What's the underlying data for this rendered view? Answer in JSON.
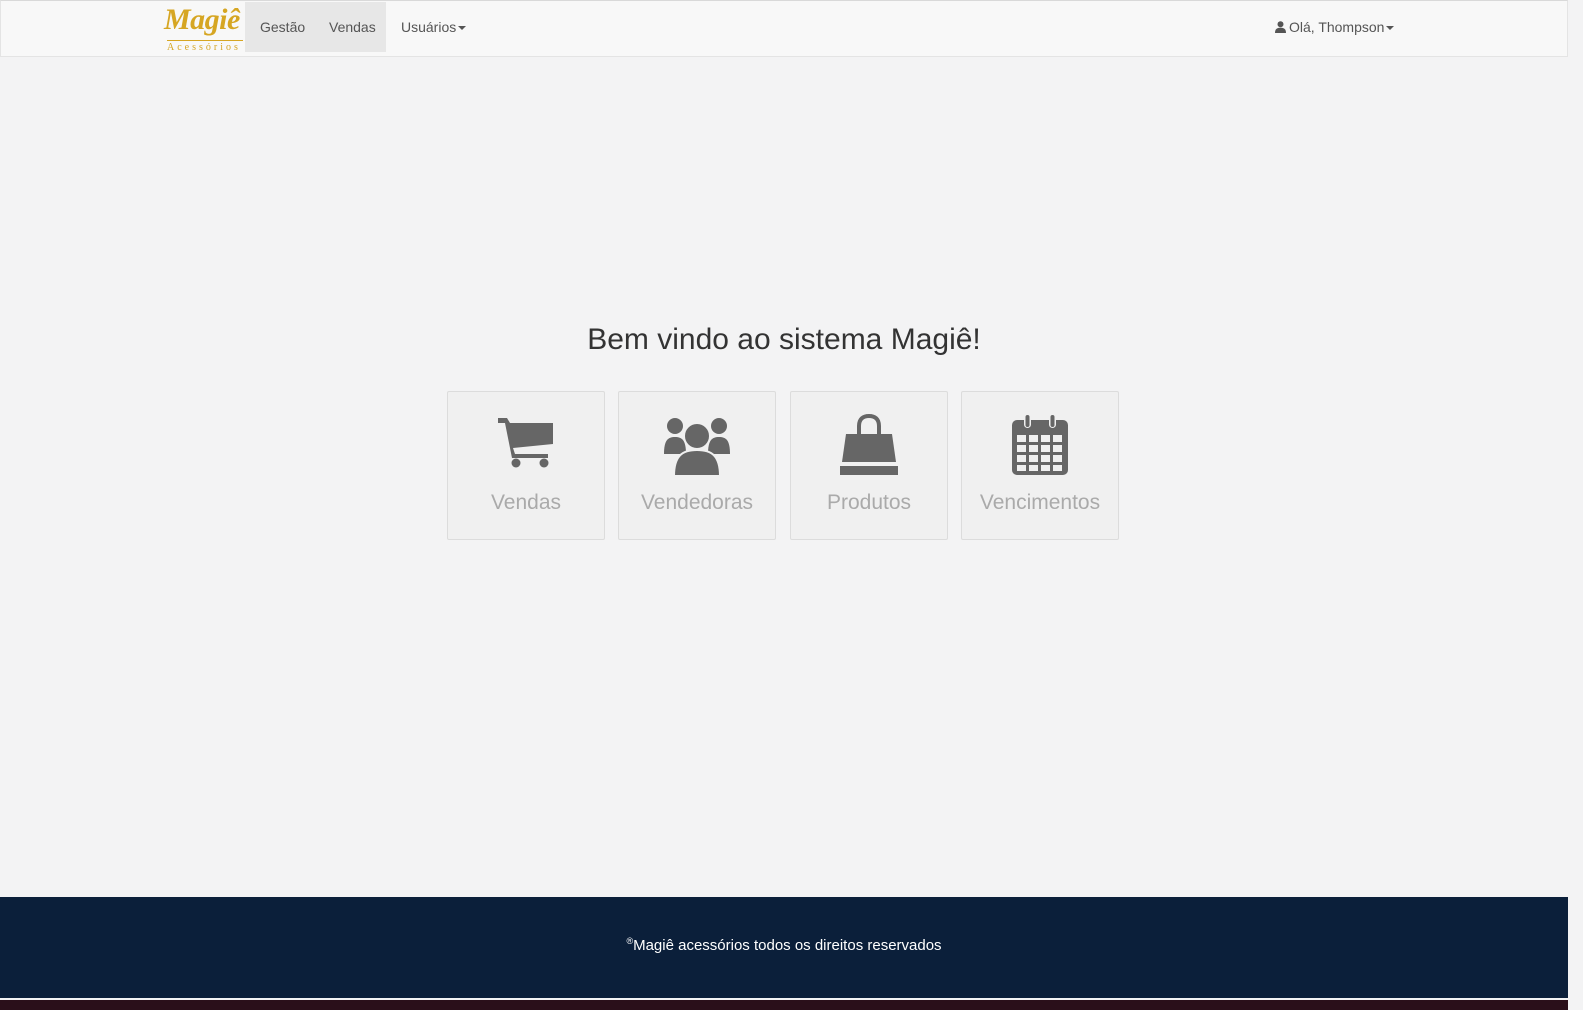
{
  "brand": {
    "name": "Magiê",
    "tagline": "Acessórios",
    "color": "#d6a623"
  },
  "nav": {
    "items": [
      {
        "label": "Gestão",
        "active": true
      },
      {
        "label": "Vendas",
        "active": true
      },
      {
        "label": "Usuários",
        "dropdown": true
      }
    ],
    "user_greeting": "Olá, Thompson",
    "user_icon": "user-icon"
  },
  "main": {
    "welcome": "Bem vindo ao sistema Magiê!",
    "tiles": [
      {
        "label": "Vendas",
        "icon": "shopping-cart-icon"
      },
      {
        "label": "Vendedoras",
        "icon": "users-group-icon"
      },
      {
        "label": "Produtos",
        "icon": "shopping-bag-icon"
      },
      {
        "label": "Vencimentos",
        "icon": "calendar-icon"
      }
    ]
  },
  "footer": {
    "symbol": "®",
    "text": "Magiê acessórios todos os direitos reservados",
    "background": "#0b1f3a"
  }
}
